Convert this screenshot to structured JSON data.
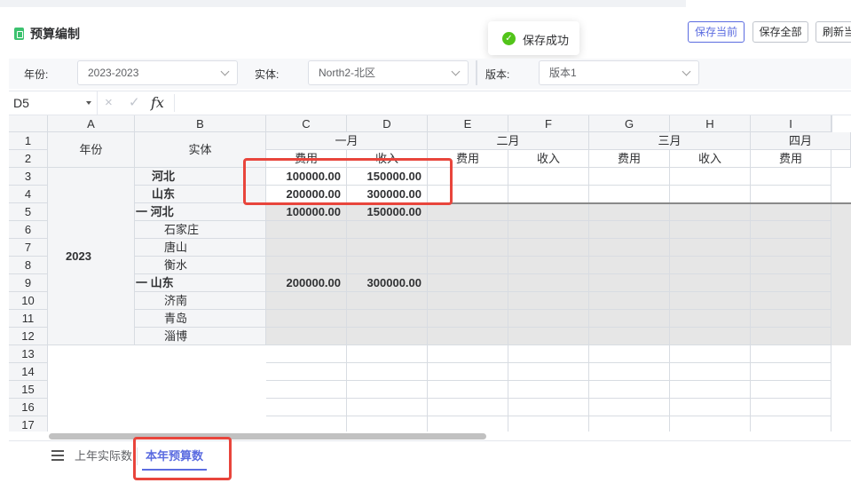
{
  "header": {
    "title": "预算编制",
    "buttons": [
      "保存当前",
      "保存全部",
      "刷新当"
    ]
  },
  "toast": {
    "message": "保存成功",
    "icon": "check-circle-icon"
  },
  "filters": {
    "year_label": "年份:",
    "year_value": "2023-2023",
    "entity_label": "实体:",
    "entity_value": "North2-北区",
    "version_label": "版本:",
    "version_value": "版本1"
  },
  "formula_bar": {
    "cell_ref": "D5",
    "fx": "fx",
    "cancel_icon": "×",
    "confirm_icon": "✓"
  },
  "grid": {
    "col_headers": [
      "A",
      "B",
      "C",
      "D",
      "E",
      "F",
      "G",
      "H",
      "I"
    ],
    "row_numbers": [
      "1",
      "2",
      "3",
      "4",
      "5",
      "6",
      "7",
      "8",
      "9",
      "10",
      "11",
      "12",
      "13",
      "14",
      "15",
      "16",
      "17"
    ],
    "h_year": "年份",
    "h_entity": "实体",
    "months": [
      "一月",
      "二月",
      "三月",
      "四月"
    ],
    "sub_headers": [
      "费用",
      "收入",
      "费用",
      "收入",
      "费用",
      "收入",
      "费用"
    ],
    "year": "2023",
    "entities": [
      {
        "label": "河北",
        "bold": true
      },
      {
        "label": "山东",
        "bold": true
      },
      {
        "label": "一 河北",
        "bold": true
      },
      {
        "label": "石家庄",
        "bold": false
      },
      {
        "label": "唐山",
        "bold": false
      },
      {
        "label": "衡水",
        "bold": false
      },
      {
        "label": "一 山东",
        "bold": true
      },
      {
        "label": "济南",
        "bold": false
      },
      {
        "label": "青岛",
        "bold": false
      },
      {
        "label": "淄博",
        "bold": false
      }
    ],
    "values": {
      "r3": [
        "100000.00",
        "150000.00"
      ],
      "r4": [
        "200000.00",
        "300000.00"
      ],
      "r5": [
        "100000.00",
        "150000.00"
      ],
      "r9": [
        "200000.00",
        "300000.00"
      ]
    }
  },
  "sheets": {
    "tabs": [
      "上年实际数",
      "本年预算数"
    ],
    "active": "本年预算数"
  },
  "colors": {
    "accent": "#5b6ce0",
    "highlight": "#e8453c",
    "success": "#52c41a"
  }
}
